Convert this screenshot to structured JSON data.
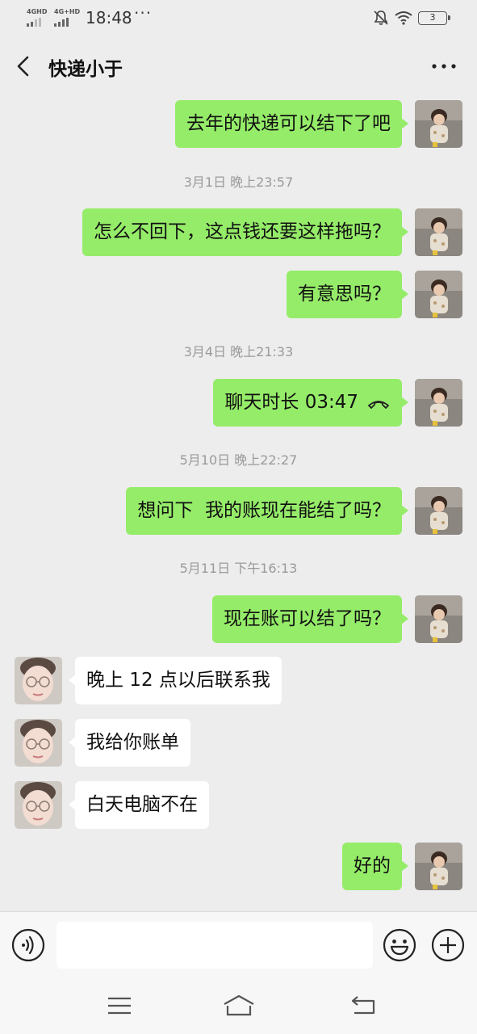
{
  "status_bar": {
    "signal1_label": "4GHD",
    "signal2_label": "4G+HD",
    "time": "18:48",
    "overflow": "···",
    "battery": "3",
    "icons": [
      "signal-icon",
      "bell-muted-icon",
      "wifi-icon",
      "battery-icon"
    ]
  },
  "header": {
    "title": "快递小于",
    "back_icon": "back-chevron-icon",
    "more_icon": "more-dots-icon"
  },
  "messages": [
    {
      "type": "out",
      "text": "去年的快递可以结下了吧"
    },
    {
      "type": "time",
      "text": "3月1日 晚上23:57"
    },
    {
      "type": "out",
      "text": "怎么不回下，这点钱还要这样拖吗？"
    },
    {
      "type": "out",
      "text": "有意思吗？"
    },
    {
      "type": "time",
      "text": "3月4日 晚上21:33"
    },
    {
      "type": "out",
      "text": "聊天时长 03:47",
      "icon": "call-ended-icon"
    },
    {
      "type": "time",
      "text": "5月10日 晚上22:27"
    },
    {
      "type": "out",
      "text": "想问下  我的账现在能结了吗？"
    },
    {
      "type": "time",
      "text": "5月11日 下午16:13"
    },
    {
      "type": "out",
      "text": "现在账可以结了吗？"
    },
    {
      "type": "in",
      "text": "晚上 12 点以后联系我"
    },
    {
      "type": "in",
      "text": "我给你账单"
    },
    {
      "type": "in",
      "text": "白天电脑不在"
    },
    {
      "type": "out",
      "text": "好的"
    }
  ],
  "input_bar": {
    "value": "",
    "placeholder": "",
    "icons": [
      "voice-icon",
      "emoji-icon",
      "plus-icon"
    ]
  },
  "nav_bar": {
    "icons": [
      "menu-icon",
      "home-icon",
      "back-icon"
    ]
  },
  "colors": {
    "background": "#ededed",
    "out_bubble": "#95ec69",
    "in_bubble": "#ffffff",
    "timestamp": "#9a9a9a"
  }
}
